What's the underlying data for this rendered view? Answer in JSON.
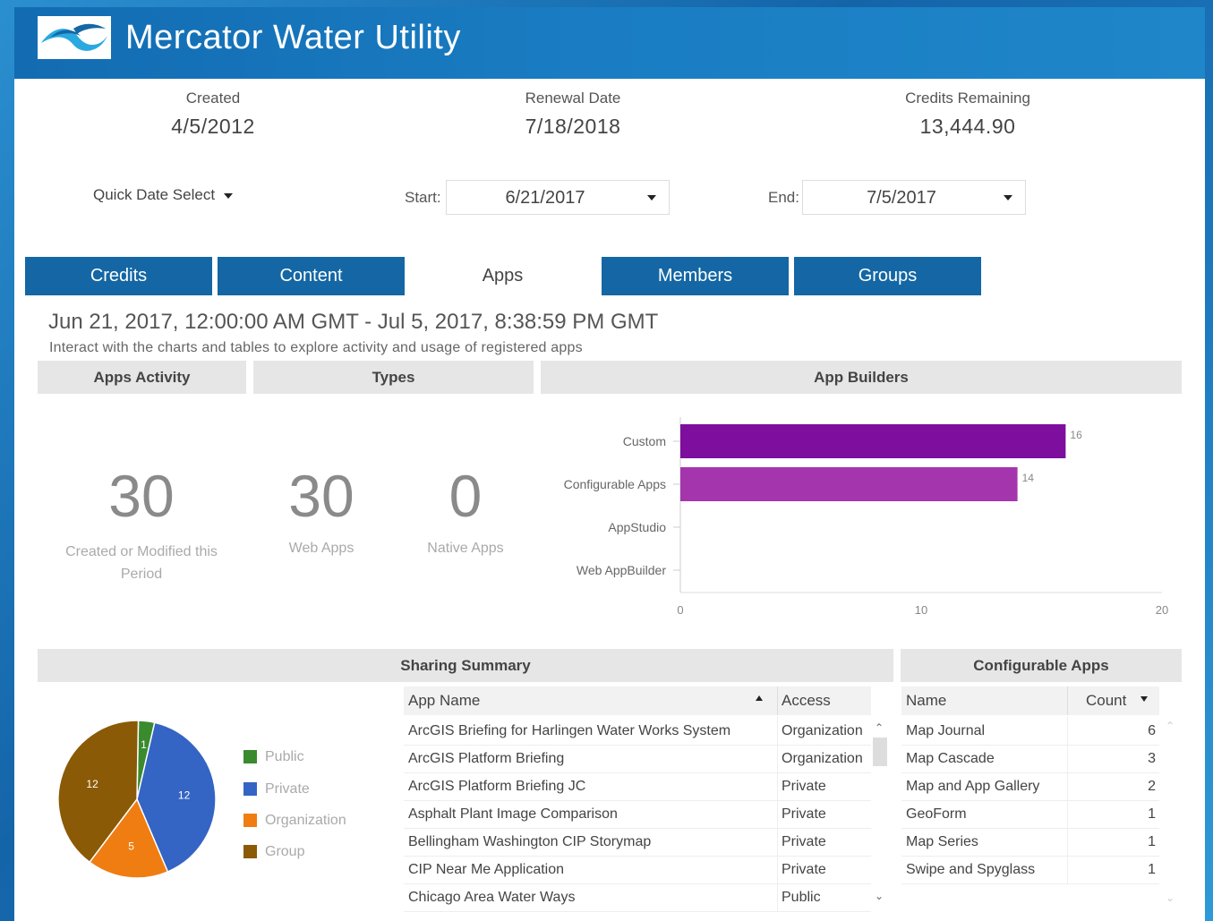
{
  "header": {
    "title": "Mercator Water Utility"
  },
  "stats": [
    {
      "label": "Created",
      "value": "4/5/2012"
    },
    {
      "label": "Renewal Date",
      "value": "7/18/2018"
    },
    {
      "label": "Credits Remaining",
      "value": "13,444.90"
    }
  ],
  "filters": {
    "quick_date_select": "Quick Date Select",
    "start_label": "Start:",
    "start_value": "6/21/2017",
    "end_label": "End:",
    "end_value": "7/5/2017"
  },
  "tabs": [
    {
      "label": "Credits"
    },
    {
      "label": "Content"
    },
    {
      "label": "Apps"
    },
    {
      "label": "Members"
    },
    {
      "label": "Groups"
    }
  ],
  "period": {
    "range": "Jun 21, 2017, 12:00:00 AM GMT - Jul 5, 2017, 8:38:59 PM GMT",
    "description": "Interact with the charts and tables to explore activity and usage of registered apps"
  },
  "sections": {
    "apps_activity": "Apps Activity",
    "types": "Types",
    "app_builders": "App Builders",
    "sharing_summary": "Sharing Summary",
    "configurable_apps": "Configurable Apps"
  },
  "metrics": {
    "created_modified": {
      "value": "30",
      "label": "Created or Modified this Period"
    },
    "web_apps": {
      "value": "30",
      "label": "Web Apps"
    },
    "native_apps": {
      "value": "0",
      "label": "Native Apps"
    }
  },
  "chart_data": [
    {
      "type": "bar",
      "orientation": "horizontal",
      "categories": [
        "Custom",
        "Configurable Apps",
        "AppStudio",
        "Web AppBuilder"
      ],
      "values": [
        16,
        14,
        0,
        0
      ],
      "data_labels": [
        "16",
        "14",
        "",
        ""
      ],
      "colors": [
        "#7d0e9e",
        "#a535ad",
        "#a535ad",
        "#a535ad"
      ],
      "xlim": [
        0,
        20
      ],
      "xticks": [
        "0",
        "10",
        "20"
      ],
      "grid": false
    },
    {
      "type": "pie",
      "categories": [
        "Public",
        "Private",
        "Organization",
        "Group"
      ],
      "values": [
        1,
        12,
        5,
        12
      ],
      "data_labels": [
        "1",
        "12",
        "5",
        "12"
      ],
      "colors": [
        "#3a8a2e",
        "#3464c4",
        "#f07d12",
        "#8a5a06"
      ],
      "legend": "right"
    }
  ],
  "sharing_table": {
    "columns": [
      "App Name",
      "Access"
    ],
    "rows": [
      [
        "ArcGIS Briefing for Harlingen Water Works System",
        "Organization"
      ],
      [
        "ArcGIS Platform Briefing",
        "Organization"
      ],
      [
        "ArcGIS Platform Briefing JC",
        "Private"
      ],
      [
        "Asphalt Plant Image Comparison",
        "Private"
      ],
      [
        "Bellingham Washington CIP Storymap",
        "Private"
      ],
      [
        "CIP Near Me Application",
        "Private"
      ],
      [
        "Chicago Area Water Ways",
        "Public"
      ]
    ]
  },
  "config_table": {
    "columns": [
      "Name",
      "Count"
    ],
    "rows": [
      [
        "Map Journal",
        "6"
      ],
      [
        "Map Cascade",
        "3"
      ],
      [
        "Map and App Gallery",
        "2"
      ],
      [
        "GeoForm",
        "1"
      ],
      [
        "Map Series",
        "1"
      ],
      [
        "Swipe and Spyglass",
        "1"
      ]
    ]
  }
}
